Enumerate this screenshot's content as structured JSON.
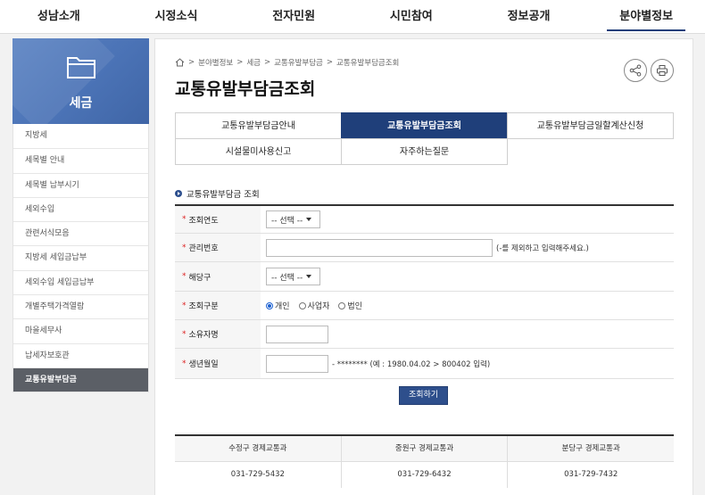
{
  "topnav": {
    "items": [
      "성남소개",
      "시정소식",
      "전자민원",
      "시민참여",
      "정보공개",
      "분야별정보"
    ],
    "active_index": 5
  },
  "sidebar": {
    "title": "세금",
    "items": [
      "지방세",
      "세목별 안내",
      "세목별 납부시기",
      "세외수입",
      "관련서식모음",
      "지방세 세입금납부",
      "세외수입 세입금납부",
      "개별주택가격열람",
      "마을세무사",
      "납세자보호관",
      "교통유발부담금"
    ],
    "active_index": 10
  },
  "breadcrumb": [
    "분야별정보",
    "세금",
    "교통유발부담금",
    "교통유발부담금조회"
  ],
  "page_title": "교통유발부담금조회",
  "tabs": [
    "교통유발부담금안내",
    "교통유발부담금조회",
    "교통유발부담금일할계산신청",
    "시설물미사용신고",
    "자주하는질문"
  ],
  "active_tab_index": 1,
  "section_title": "교통유발부담금 조회",
  "form": {
    "year_label": "조회연도",
    "year_select": "-- 선택 --",
    "mgmt_label": "관리번호",
    "mgmt_hint": "(-를 제외하고 입력해주세요.)",
    "district_label": "해당구",
    "district_select": "-- 선택 --",
    "type_label": "조회구분",
    "type_options": [
      "개인",
      "사업자",
      "법인"
    ],
    "type_selected_index": 0,
    "owner_label": "소유자명",
    "birth_label": "생년월일",
    "birth_hint": "- ******** (예 : 1980.04.02 > 800402 입력)",
    "submit_label": "조회하기"
  },
  "contact": {
    "headers": [
      "수정구 경제교통과",
      "중원구 경제교통과",
      "분당구 경제교통과"
    ],
    "phones": [
      "031-729-5432",
      "031-729-6432",
      "031-729-7432"
    ]
  },
  "colors": {
    "primary": "#1f3f7a",
    "sidebar_banner": "#4b73b6",
    "required": "#d22222"
  },
  "icons": {
    "home": "home-icon",
    "share": "share-icon",
    "print": "print-icon",
    "folder": "folder-icon"
  }
}
